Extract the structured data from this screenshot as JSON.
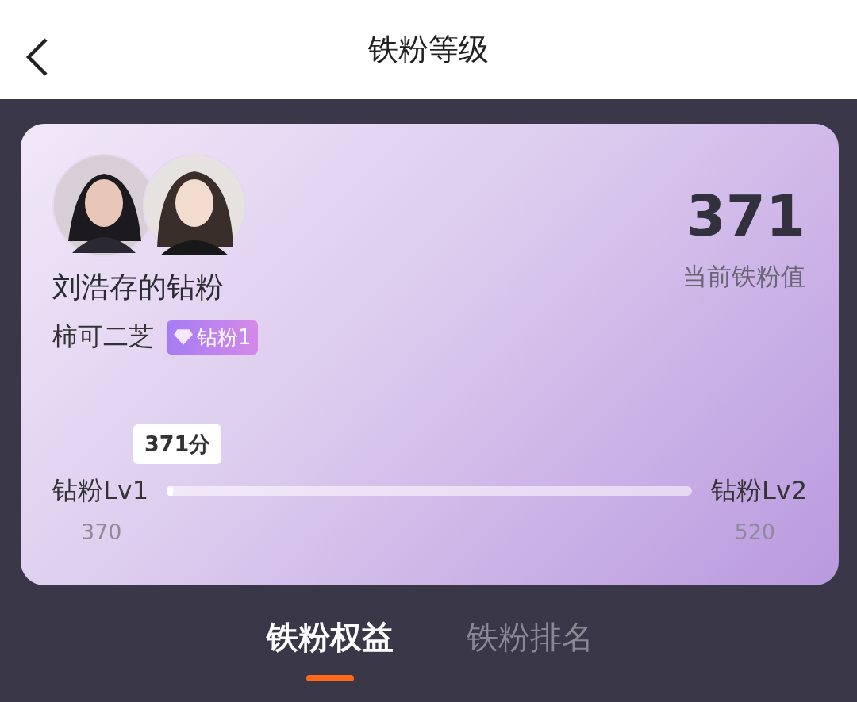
{
  "header": {
    "title": "铁粉等级"
  },
  "card": {
    "group_name": "刘浩存的钻粉",
    "user_name": "柿可二芝",
    "badge": "钻粉1",
    "score": "371",
    "score_label": "当前铁粉值",
    "progress": {
      "tooltip": "371分",
      "start_label": "钻粉Lv1",
      "end_label": "钻粉Lv2",
      "start_value": "370",
      "end_value": "520",
      "level": 0.01
    }
  },
  "tabs": [
    {
      "label": "铁粉权益",
      "selected": true
    },
    {
      "label": "铁粉排名",
      "selected": false
    }
  ]
}
